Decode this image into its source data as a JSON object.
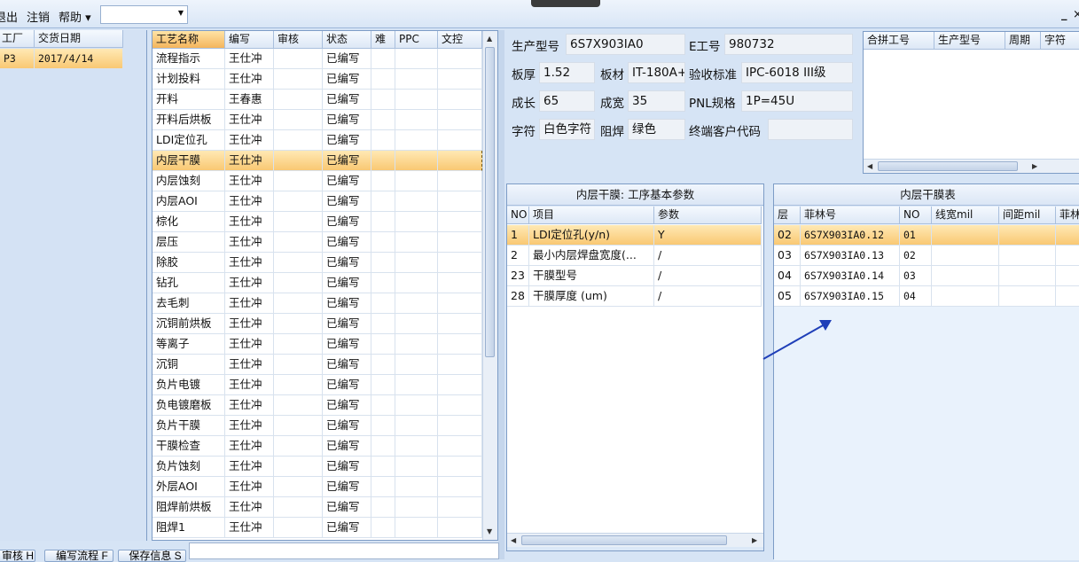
{
  "menu": {
    "exit": "退出",
    "logout": "注销",
    "help": "帮助 ▾",
    "combo_value": ""
  },
  "orders": {
    "columns": [
      "工厂",
      "交货日期"
    ],
    "rows": [
      {
        "factory": "P3",
        "date": "2017/4/14"
      }
    ]
  },
  "process": {
    "columns": [
      "工艺名称",
      "编写",
      "审核",
      "状态",
      "难",
      "PPC",
      "文控"
    ],
    "selected_index": 5,
    "rows": [
      {
        "name": "流程指示",
        "writer": "王仕冲",
        "status": "已编写"
      },
      {
        "name": "计划投料",
        "writer": "王仕冲",
        "status": "已编写"
      },
      {
        "name": "开料",
        "writer": "王春惠",
        "status": "已编写"
      },
      {
        "name": "开料后烘板",
        "writer": "王仕冲",
        "status": "已编写"
      },
      {
        "name": "LDI定位孔",
        "writer": "王仕冲",
        "status": "已编写"
      },
      {
        "name": "内层干膜",
        "writer": "王仕冲",
        "status": "已编写"
      },
      {
        "name": "内层蚀刻",
        "writer": "王仕冲",
        "status": "已编写"
      },
      {
        "name": "内层AOI",
        "writer": "王仕冲",
        "status": "已编写"
      },
      {
        "name": "棕化",
        "writer": "王仕冲",
        "status": "已编写"
      },
      {
        "name": "层压",
        "writer": "王仕冲",
        "status": "已编写"
      },
      {
        "name": "除胶",
        "writer": "王仕冲",
        "status": "已编写"
      },
      {
        "name": "钻孔",
        "writer": "王仕冲",
        "status": "已编写"
      },
      {
        "name": "去毛刺",
        "writer": "王仕冲",
        "status": "已编写"
      },
      {
        "name": "沉铜前烘板",
        "writer": "王仕冲",
        "status": "已编写"
      },
      {
        "name": "等离子",
        "writer": "王仕冲",
        "status": "已编写"
      },
      {
        "name": "沉铜",
        "writer": "王仕冲",
        "status": "已编写"
      },
      {
        "name": "负片电镀",
        "writer": "王仕冲",
        "status": "已编写"
      },
      {
        "name": "负电镀磨板",
        "writer": "王仕冲",
        "status": "已编写"
      },
      {
        "name": "负片干膜",
        "writer": "王仕冲",
        "status": "已编写"
      },
      {
        "name": "干膜检查",
        "writer": "王仕冲",
        "status": "已编写"
      },
      {
        "name": "负片蚀刻",
        "writer": "王仕冲",
        "status": "已编写"
      },
      {
        "name": "外层AOI",
        "writer": "王仕冲",
        "status": "已编写"
      },
      {
        "name": "阻焊前烘板",
        "writer": "王仕冲",
        "status": "已编写"
      },
      {
        "name": "阻焊1",
        "writer": "王仕冲",
        "status": "已编写"
      }
    ]
  },
  "info": {
    "model_label": "生产型号",
    "model": "6S7X903IA0",
    "eno_label": "E工号",
    "eno": "980732",
    "thick_label": "板厚",
    "thick": "1.52",
    "material_label": "板材",
    "material": "IT-180A+",
    "std_label": "验收标准",
    "std": "IPC-6018 III级",
    "len_label": "成长",
    "len": "65",
    "wid_label": "成宽",
    "wid": "35",
    "pnl_label": "PNL规格",
    "pnl": "1P=45U",
    "char_label": "字符",
    "char": "白色字符",
    "mask_label": "阻焊",
    "mask": "绿色",
    "cust_label": "终端客户代码",
    "cust": ""
  },
  "combined": {
    "columns": [
      "合拼工号",
      "生产型号",
      "周期",
      "字符"
    ]
  },
  "params": {
    "title": "内层干膜: 工序基本参数",
    "columns": [
      "NO",
      "项目",
      "参数"
    ],
    "rows": [
      {
        "no": "1",
        "item": "LDI定位孔(y/n)",
        "val": "Y"
      },
      {
        "no": "2",
        "item": "最小内层焊盘宽度(...",
        "val": "/"
      },
      {
        "no": "23",
        "item": "干膜型号",
        "val": "/"
      },
      {
        "no": "28",
        "item": "干膜厚度 (um)",
        "val": "/"
      }
    ]
  },
  "film": {
    "title": "内层干膜表",
    "columns": [
      "层",
      "菲林号",
      "NO",
      "线宽mil",
      "间距mil",
      "菲林"
    ],
    "rows": [
      {
        "layer": "02",
        "film": "6S7X903IA0.12",
        "no": "01"
      },
      {
        "layer": "03",
        "film": "6S7X903IA0.13",
        "no": "02"
      },
      {
        "layer": "04",
        "film": "6S7X903IA0.14",
        "no": "03"
      },
      {
        "layer": "05",
        "film": "6S7X903IA0.15",
        "no": "04"
      }
    ]
  },
  "buttons": {
    "review": "审核 H",
    "write_flow": "编写流程 F",
    "save_info": "保存信息 S"
  },
  "colors": {
    "selection": "#f9c873",
    "arrow": "#1f3fb8"
  }
}
